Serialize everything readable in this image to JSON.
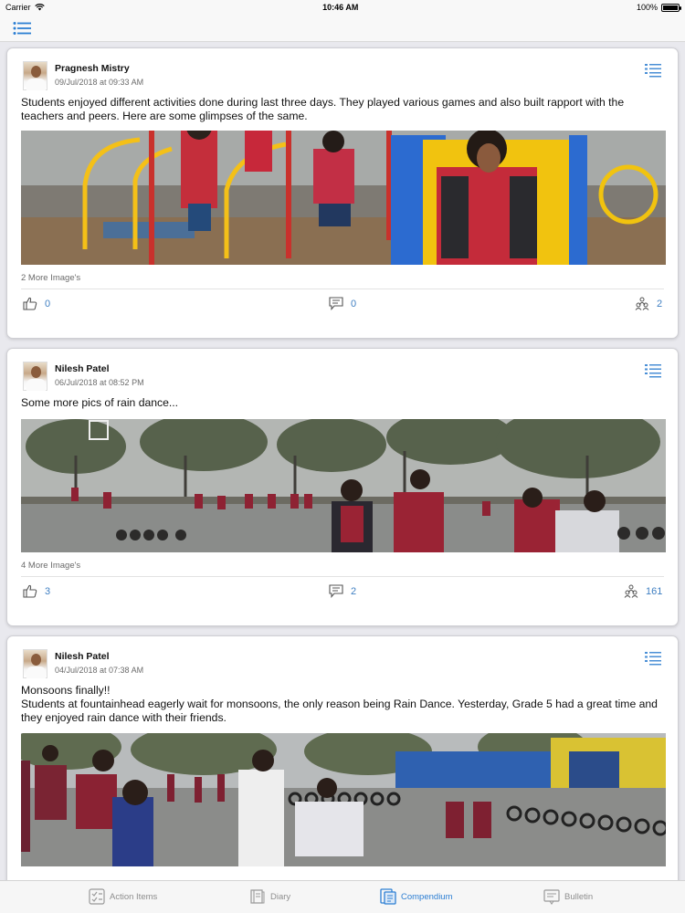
{
  "status_bar": {
    "carrier": "Carrier",
    "time": "10:46 AM",
    "battery": "100%",
    "battery_level": 1.0
  },
  "nav": {
    "menu_icon": "list-icon"
  },
  "posts": [
    {
      "author": "Pragnesh Mistry",
      "date": "09/Jul/2018 at 09:33 AM",
      "text": "Students enjoyed different activities done during last three days. They played various games and also built rapport with the teachers and peers. Here are some glimpses of the same.",
      "more_images": "2 More Image's",
      "likes": "0",
      "comments": "0",
      "views": "2"
    },
    {
      "author": "Nilesh Patel",
      "date": "06/Jul/2018 at 08:52 PM",
      "text": "Some more pics of rain dance...",
      "more_images": "4 More Image's",
      "likes": "3",
      "comments": "2",
      "views": "161"
    },
    {
      "author": "Nilesh Patel",
      "date": "04/Jul/2018 at 07:38 AM",
      "text_line1": "Monsoons finally!!",
      "text_line2": "Students at fountainhead eagerly wait for monsoons, the only reason being Rain Dance. Yesterday, Grade 5 had a great time and they enjoyed rain dance with their friends."
    }
  ],
  "tabs": [
    {
      "label": "Action Items",
      "icon": "checklist-icon",
      "active": false
    },
    {
      "label": "Diary",
      "icon": "book-icon",
      "active": false
    },
    {
      "label": "Compendium",
      "icon": "compendium-icon",
      "active": true
    },
    {
      "label": "Bulletin",
      "icon": "bulletin-icon",
      "active": false
    }
  ],
  "colors": {
    "accent": "#2d7fd3",
    "link": "#3f7fc2",
    "inactive_tab": "#8e8e8e"
  }
}
